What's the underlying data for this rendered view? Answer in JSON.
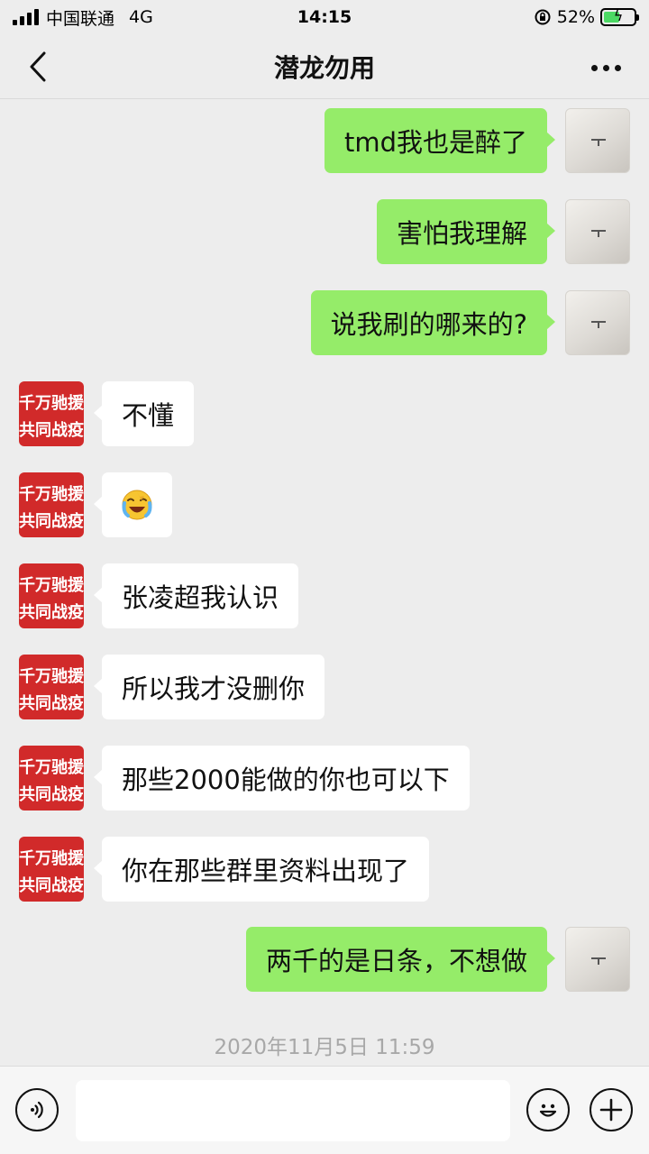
{
  "status_bar": {
    "carrier": "中国联通",
    "network": "4G",
    "time": "14:15",
    "battery": "52%",
    "battery_level": 0.52
  },
  "header": {
    "back_icon": "chevron-left-icon",
    "title": "潜龙勿用",
    "more_icon": "more-dots-icon"
  },
  "messages": [
    {
      "side": "self",
      "text": "tmd我也是醉了"
    },
    {
      "side": "self",
      "text": "害怕我理解"
    },
    {
      "side": "self",
      "text": "说我刷的哪来的?"
    },
    {
      "side": "other",
      "text": "不懂"
    },
    {
      "side": "other",
      "type": "emoji",
      "emoji": "face-with-tears-emoji"
    },
    {
      "side": "other",
      "text": "张凌超我认识"
    },
    {
      "side": "other",
      "text": "所以我才没删你"
    },
    {
      "side": "other",
      "text": "那些2000能做的你也可以下"
    },
    {
      "side": "other",
      "text": "你在那些群里资料出现了"
    },
    {
      "side": "self",
      "text": "两千的是日条，不想做"
    }
  ],
  "other_avatar_text": [
    "千万驰援",
    "共同战疫"
  ],
  "timestamp": "2020年11月5日 11:59",
  "input_bar": {
    "voice_icon": "voice-icon",
    "emoji_icon": "emoji-icon",
    "plus_icon": "plus-icon",
    "placeholder": ""
  },
  "colors": {
    "background": "#ededed",
    "self_bubble": "#95ec69",
    "other_bubble": "#ffffff",
    "avatar_red": "#d12a2a"
  }
}
